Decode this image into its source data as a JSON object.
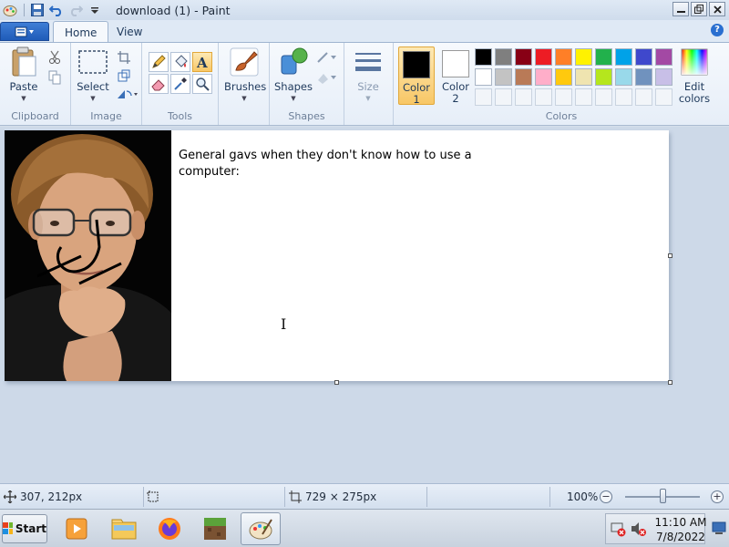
{
  "window": {
    "title": "download (1) - Paint"
  },
  "tabs": {
    "home": "Home",
    "view": "View"
  },
  "ribbon": {
    "paste": "Paste",
    "select": "Select",
    "brushes": "Brushes",
    "shapes": "Shapes",
    "size": "Size",
    "color1_line1": "Color",
    "color1_line2": "1",
    "color2_line1": "Color",
    "color2_line2": "2",
    "edit_colors_line1": "Edit",
    "edit_colors_line2": "colors",
    "groups": {
      "clipboard": "Clipboard",
      "image": "Image",
      "tools": "Tools",
      "shapes": "Shapes",
      "colors": "Colors"
    }
  },
  "colors": {
    "color1": "#000000",
    "color2": "#ffffff",
    "palette_row1": [
      "#000000",
      "#7f7f7f",
      "#880015",
      "#ed1c24",
      "#ff7f27",
      "#fff200",
      "#22b14c",
      "#00a2e8",
      "#3f48cc",
      "#a349a4"
    ],
    "palette_row2": [
      "#ffffff",
      "#c3c3c3",
      "#b97a57",
      "#ffaec9",
      "#ffc90e",
      "#efe4b0",
      "#b5e61d",
      "#99d9ea",
      "#7092be",
      "#c8bfe7"
    ]
  },
  "canvas": {
    "text_line1": "General gavs when they don't know how to use a",
    "text_line2": "computer:"
  },
  "status": {
    "cursor_pos": "307, 212px",
    "image_size": "729 × 275px",
    "zoom": "100%"
  },
  "taskbar": {
    "start": "Start",
    "time": "11:10 AM",
    "date": "7/8/2022"
  }
}
